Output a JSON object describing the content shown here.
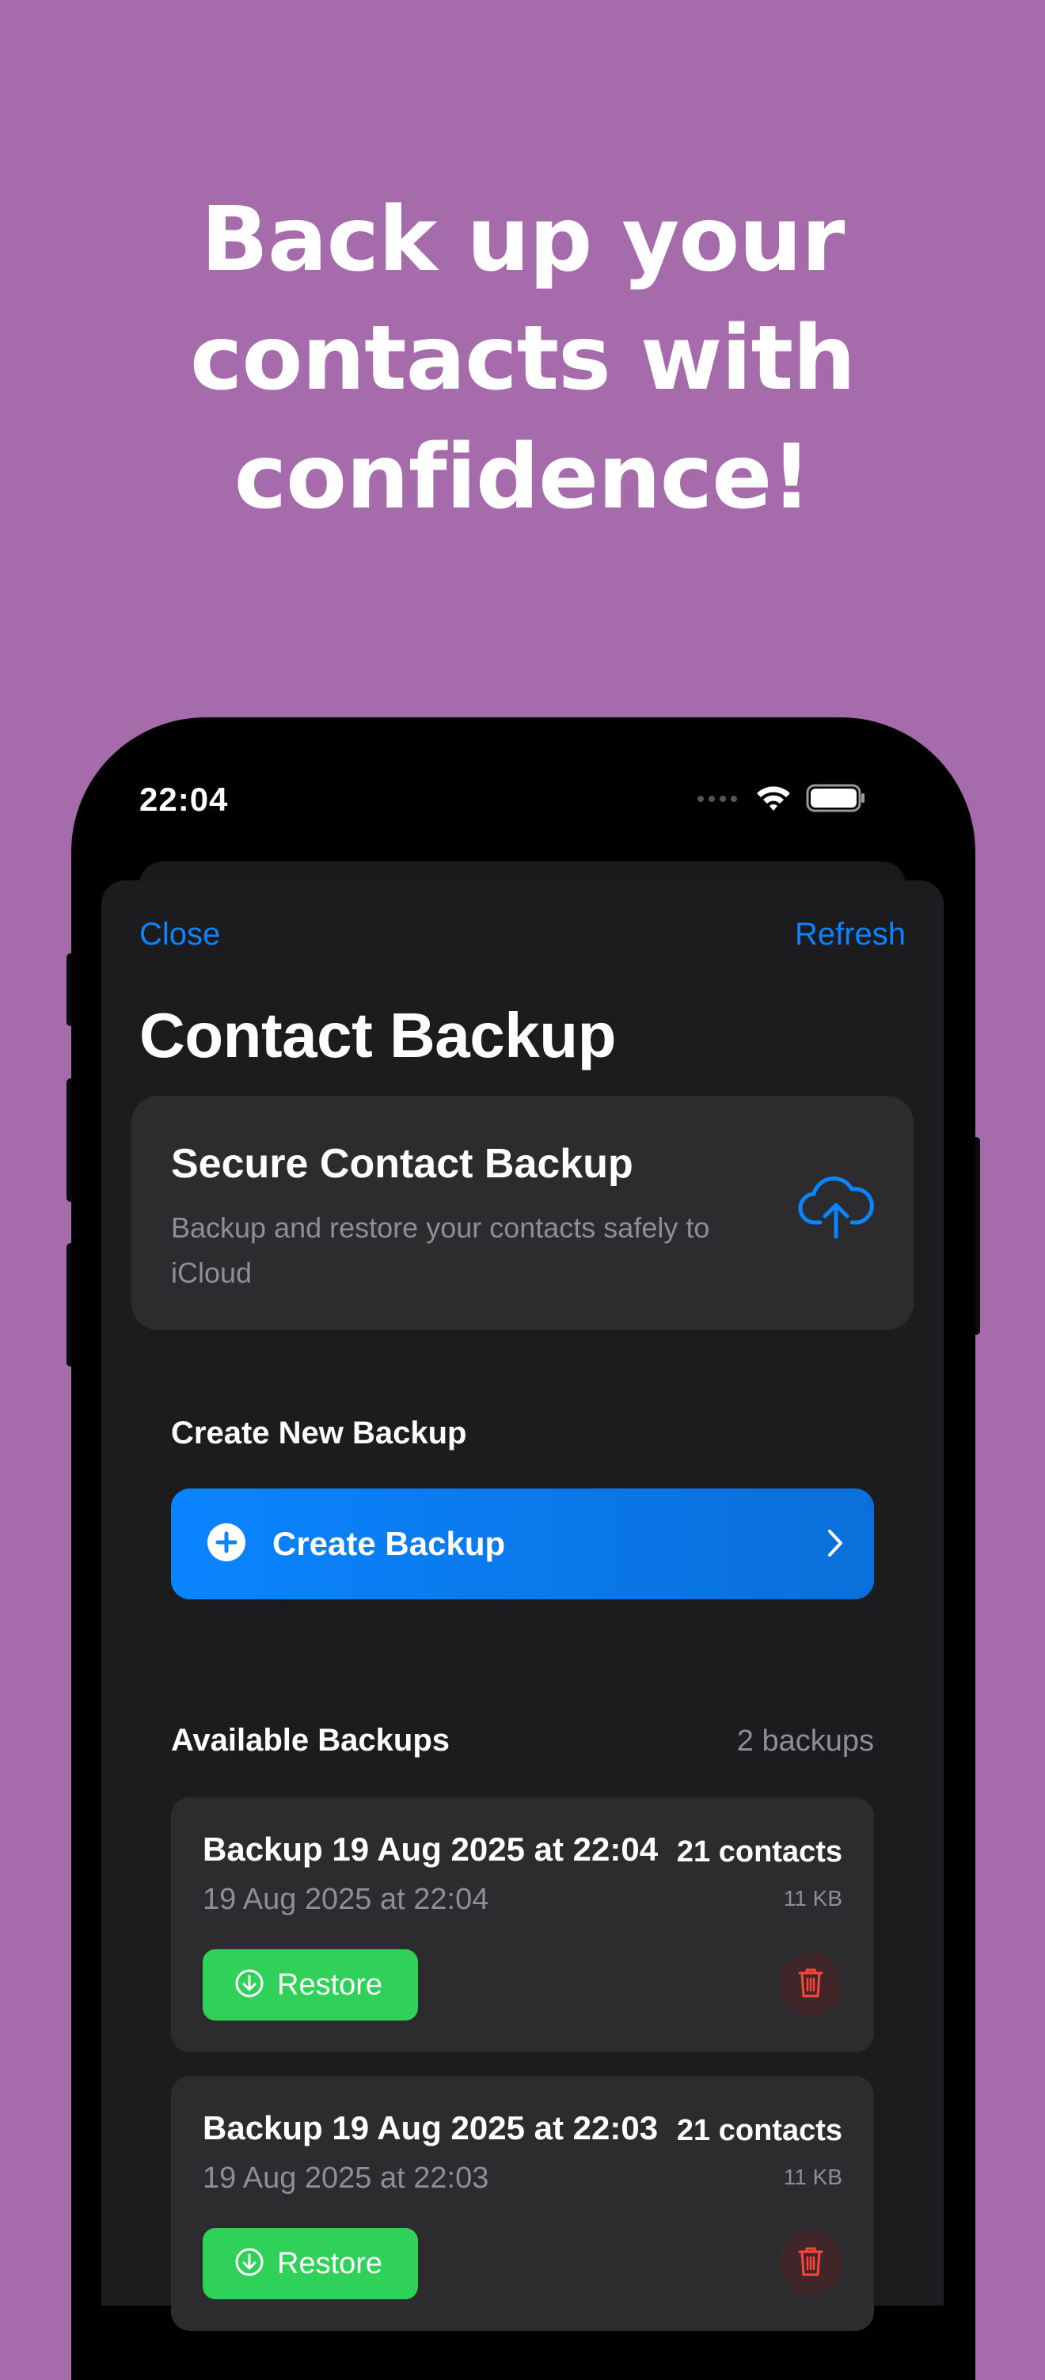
{
  "headline": [
    "Back up your",
    "contacts with",
    "confidence!"
  ],
  "status_bar": {
    "time": "22:04",
    "icons": [
      "signal-icon",
      "wifi-icon",
      "battery-icon"
    ]
  },
  "nav": {
    "close": "Close",
    "refresh": "Refresh"
  },
  "page_title": "Contact Backup",
  "hero": {
    "title": "Secure Contact Backup",
    "subtitle": "Backup and restore your contacts safely to iCloud",
    "icon": "cloud-upload-icon"
  },
  "create_section": {
    "label": "Create New Backup",
    "button": "Create Backup"
  },
  "backups_section": {
    "label": "Available Backups",
    "count": "2 backups",
    "items": [
      {
        "name": "Backup 19 Aug 2025 at 22:04",
        "date": "19 Aug 2025 at 22:04",
        "contacts": "21 contacts",
        "size": "11 KB",
        "restore": "Restore"
      },
      {
        "name": "Backup 19 Aug 2025 at 22:03",
        "date": "19 Aug 2025 at 22:03",
        "contacts": "21 contacts",
        "size": "11 KB",
        "restore": "Restore"
      }
    ]
  },
  "colors": {
    "background": "#a66bab",
    "accent": "#0a84ff",
    "restore": "#30d158",
    "delete": "#ff453a"
  }
}
